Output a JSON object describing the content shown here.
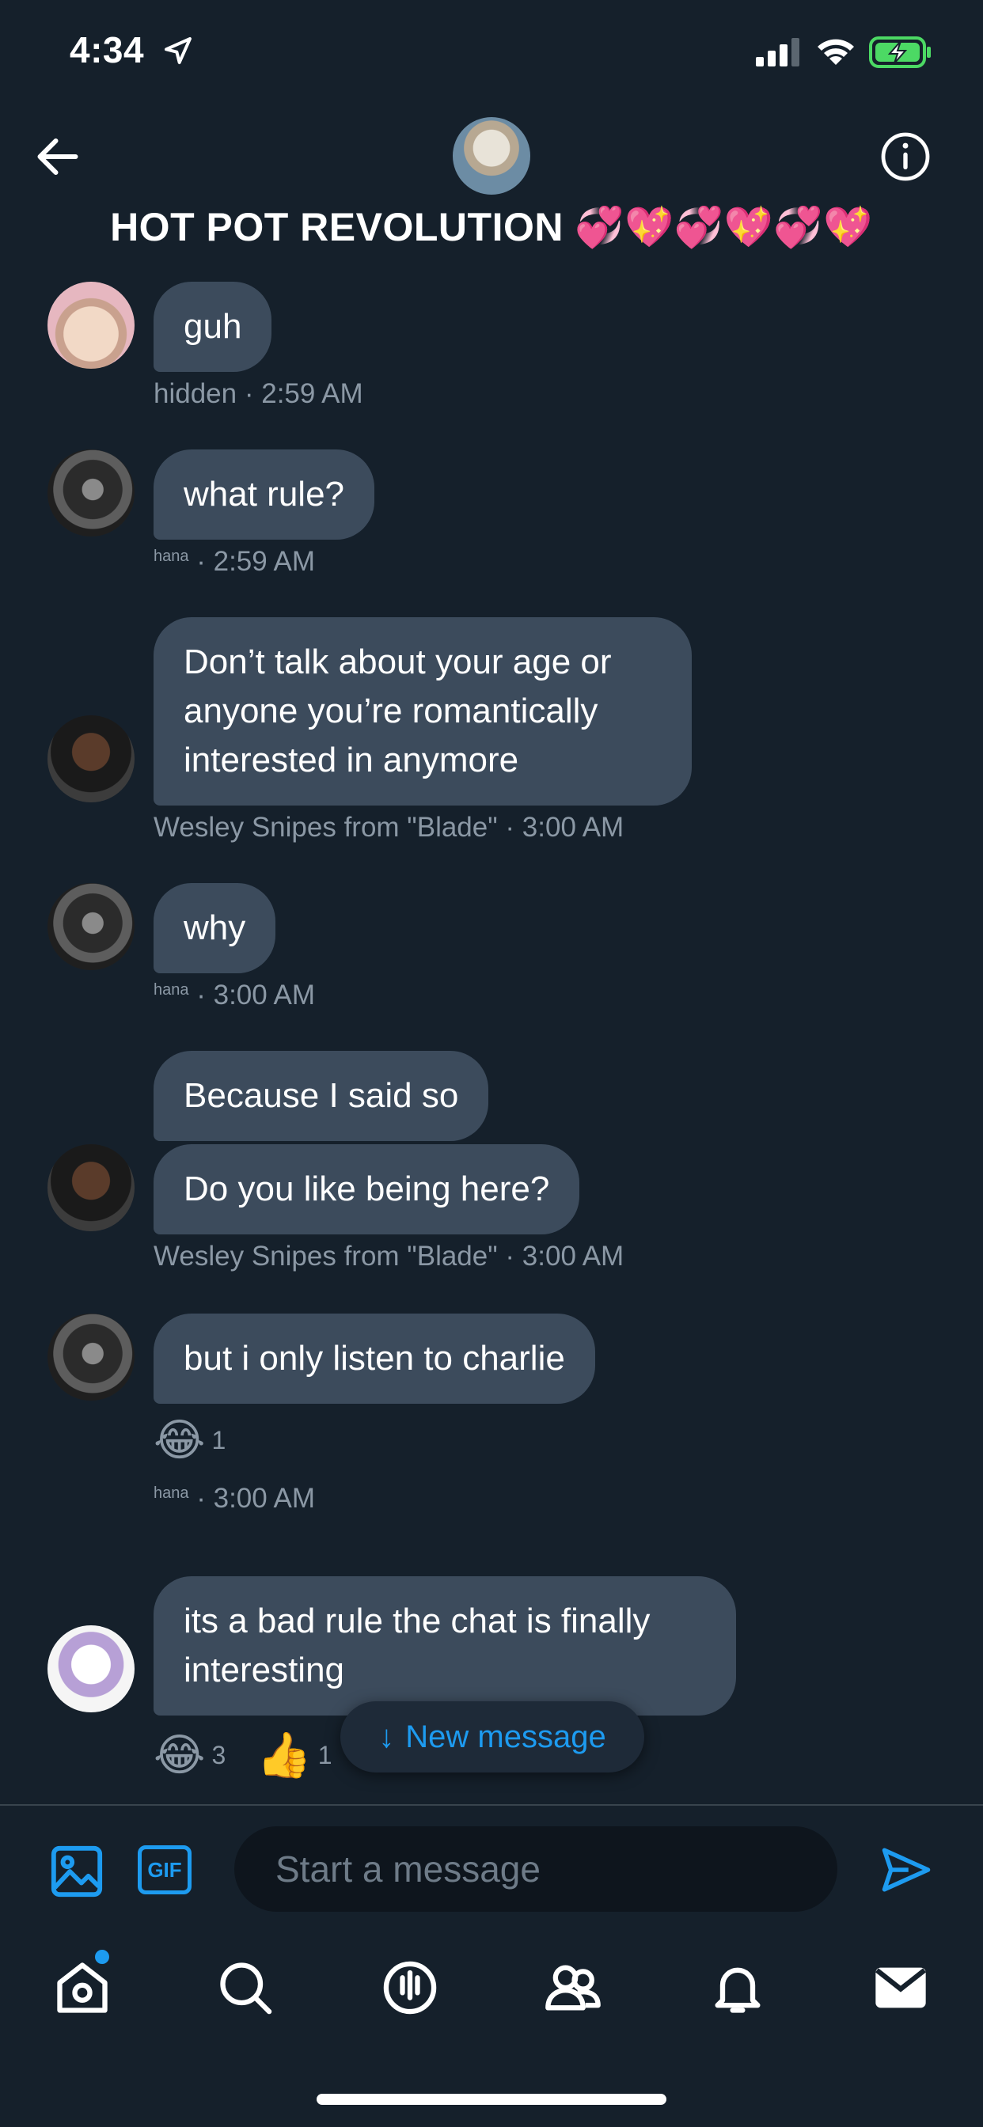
{
  "status_bar": {
    "time": "4:34"
  },
  "header": {
    "title": "HOT POT REVOLUTION 💞💖💞💖💞💖",
    "back_icon": "back-arrow-icon",
    "info_icon": "info-icon"
  },
  "messages": [
    {
      "text": "guh",
      "author": "hidden",
      "time": "· 2:59 AM"
    },
    {
      "text": "what rule?",
      "author": "hana",
      "time": "· 2:59 AM"
    },
    {
      "text": "Don’t talk about your age or anyone you’re romantically interested in anymore",
      "author": "Wesley Snipes from \"Blade\"",
      "time": "· 3:00 AM"
    },
    {
      "text": "why",
      "author": "hana",
      "time": "· 3:00 AM"
    },
    {
      "text": "Because I said so",
      "author": "",
      "time": ""
    },
    {
      "text": "Do you like being here?",
      "author": "Wesley Snipes from \"Blade\"",
      "time": "· 3:00 AM"
    },
    {
      "text": "but i only listen to charlie",
      "author": "hana",
      "time": "· 3:00 AM",
      "reactions": [
        {
          "emoji": "😂",
          "count": "1"
        }
      ]
    },
    {
      "text": "its a bad rule the chat is finally interesting",
      "author": "",
      "time": "",
      "reactions": [
        {
          "emoji": "😂",
          "count": "3"
        },
        {
          "emoji": "👍",
          "count": "1"
        }
      ]
    }
  ],
  "new_message_pill": {
    "label": "New message",
    "arrow": "↓"
  },
  "composer": {
    "placeholder": "Start a message",
    "gif_label": "GIF"
  },
  "colors": {
    "background": "#15202b",
    "bubble": "#3c4b5c",
    "accent": "#1d9bf0",
    "meta": "#8b98a5"
  },
  "nav": [
    "home-icon",
    "search-icon",
    "spaces-icon",
    "communities-icon",
    "notifications-icon",
    "messages-icon"
  ]
}
